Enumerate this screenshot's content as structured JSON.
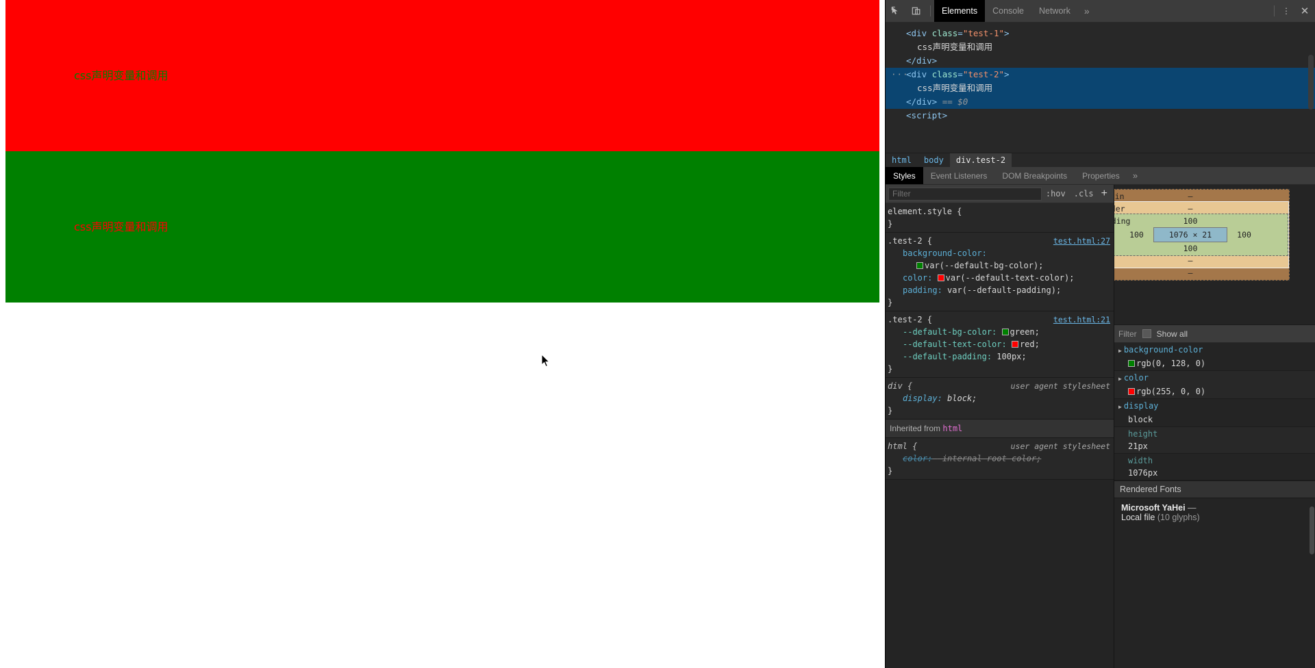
{
  "webpage": {
    "blocks": [
      {
        "name": "test-1",
        "text": "css声明变量和调用",
        "bg": "#ff0000",
        "fg": "#008000"
      },
      {
        "name": "test-2",
        "text": "css声明变量和调用",
        "bg": "#008000",
        "fg": "#ff0000"
      }
    ]
  },
  "devtools": {
    "toolbar": {
      "inspect_icon": "inspect-element-icon",
      "device_icon": "device-toolbar-icon",
      "tabs": [
        {
          "label": "Elements",
          "active": true
        },
        {
          "label": "Console",
          "active": false
        },
        {
          "label": "Network",
          "active": false
        }
      ],
      "more_tabs_chevron": "»",
      "more_menu": "⋮",
      "close": "✕"
    },
    "dom_tree": {
      "lines": [
        {
          "type": "open",
          "tag": "div",
          "attr": "class",
          "value": "test-1",
          "selected": false
        },
        {
          "type": "text",
          "text": "css声明变量和调用",
          "selected": false
        },
        {
          "type": "close",
          "tag": "div",
          "selected": false
        },
        {
          "type": "open",
          "tag": "div",
          "attr": "class",
          "value": "test-2",
          "selected": true,
          "ellipsis": "···"
        },
        {
          "type": "text",
          "text": "css声明变量和调用",
          "selected": true
        },
        {
          "type": "close",
          "tag": "div",
          "selected": true,
          "suffix": "== $0"
        },
        {
          "type": "open_plain",
          "tag": "script",
          "selected": false
        }
      ]
    },
    "breadcrumb": [
      {
        "label": "html",
        "active": false
      },
      {
        "label": "body",
        "active": false
      },
      {
        "label": "div.test-2",
        "active": true
      }
    ],
    "sidebar_tabs": [
      {
        "label": "Styles",
        "active": true
      },
      {
        "label": "Event Listeners",
        "active": false
      },
      {
        "label": "DOM Breakpoints",
        "active": false
      },
      {
        "label": "Properties",
        "active": false
      }
    ],
    "sidebar_tabs_chevron": "»",
    "styles": {
      "filter_placeholder": "Filter",
      "hov_label": ":hov",
      "cls_label": ".cls",
      "add_rule_label": "+",
      "rules": [
        {
          "selector": "element.style {",
          "origin": "",
          "origin_kind": "none",
          "declarations": [],
          "close": "}"
        },
        {
          "selector": ".test-2 {",
          "origin": "test.html:27",
          "origin_kind": "link",
          "declarations": [
            {
              "prop": "background-color:",
              "value": "var(--default-bg-color);",
              "swatch": "#008000",
              "wrapped": true,
              "custom": false
            },
            {
              "prop": "color:",
              "value": "var(--default-text-color);",
              "swatch": "#ff0000",
              "wrapped": false,
              "custom": false
            },
            {
              "prop": "padding:",
              "value": "var(--default-padding);",
              "swatch": "",
              "wrapped": false,
              "custom": false
            }
          ],
          "close": "}"
        },
        {
          "selector": ".test-2 {",
          "origin": "test.html:21",
          "origin_kind": "link",
          "declarations": [
            {
              "prop": "--default-bg-color:",
              "value": "green;",
              "swatch": "#008000",
              "wrapped": false,
              "custom": true
            },
            {
              "prop": "--default-text-color:",
              "value": "red;",
              "swatch": "#ff0000",
              "wrapped": false,
              "custom": true
            },
            {
              "prop": "--default-padding:",
              "value": "100px;",
              "swatch": "",
              "wrapped": false,
              "custom": true
            }
          ],
          "close": "}"
        },
        {
          "selector": "div {",
          "origin": "user agent stylesheet",
          "origin_kind": "ua",
          "ua": true,
          "declarations": [
            {
              "prop": "display:",
              "value": "block;",
              "swatch": "",
              "wrapped": false,
              "custom": false
            }
          ],
          "close": "}"
        }
      ],
      "inherited_header_text": "Inherited from ",
      "inherited_header_element": "html",
      "inherited_rule": {
        "selector": "html {",
        "origin": "user agent stylesheet",
        "origin_kind": "ua",
        "ua": true,
        "declarations": [
          {
            "prop": "color:",
            "value": "-internal-root-color;",
            "struck": true
          }
        ],
        "close": "}"
      }
    },
    "box_model": {
      "margin_label": "margin",
      "margin_value": "–",
      "border_label": "border",
      "border_value": "–",
      "padding_label": "padding",
      "padding_top": "100",
      "padding_left": "100",
      "padding_right": "100",
      "padding_bottom": "100",
      "content_size": "1076 × 21",
      "border_bottom_value": "–",
      "margin_bottom_value": "–"
    },
    "computed": {
      "filter_placeholder": "Filter",
      "show_all_label": "Show all",
      "properties": [
        {
          "name": "background-color",
          "value": "rgb(0, 128, 0)",
          "swatch": "#008000",
          "dim": false
        },
        {
          "name": "color",
          "value": "rgb(255, 0, 0)",
          "swatch": "#ff0000",
          "dim": false
        },
        {
          "name": "display",
          "value": "block",
          "swatch": "",
          "dim": false
        },
        {
          "name": "height",
          "value": "21px",
          "swatch": "",
          "dim": true
        },
        {
          "name": "width",
          "value": "1076px",
          "swatch": "",
          "dim": true
        }
      ]
    },
    "rendered_fonts": {
      "header": "Rendered Fonts",
      "font_name": "Microsoft YaHei",
      "dash": "—",
      "source": "Local file",
      "glyphs": "(10 glyphs)"
    }
  }
}
